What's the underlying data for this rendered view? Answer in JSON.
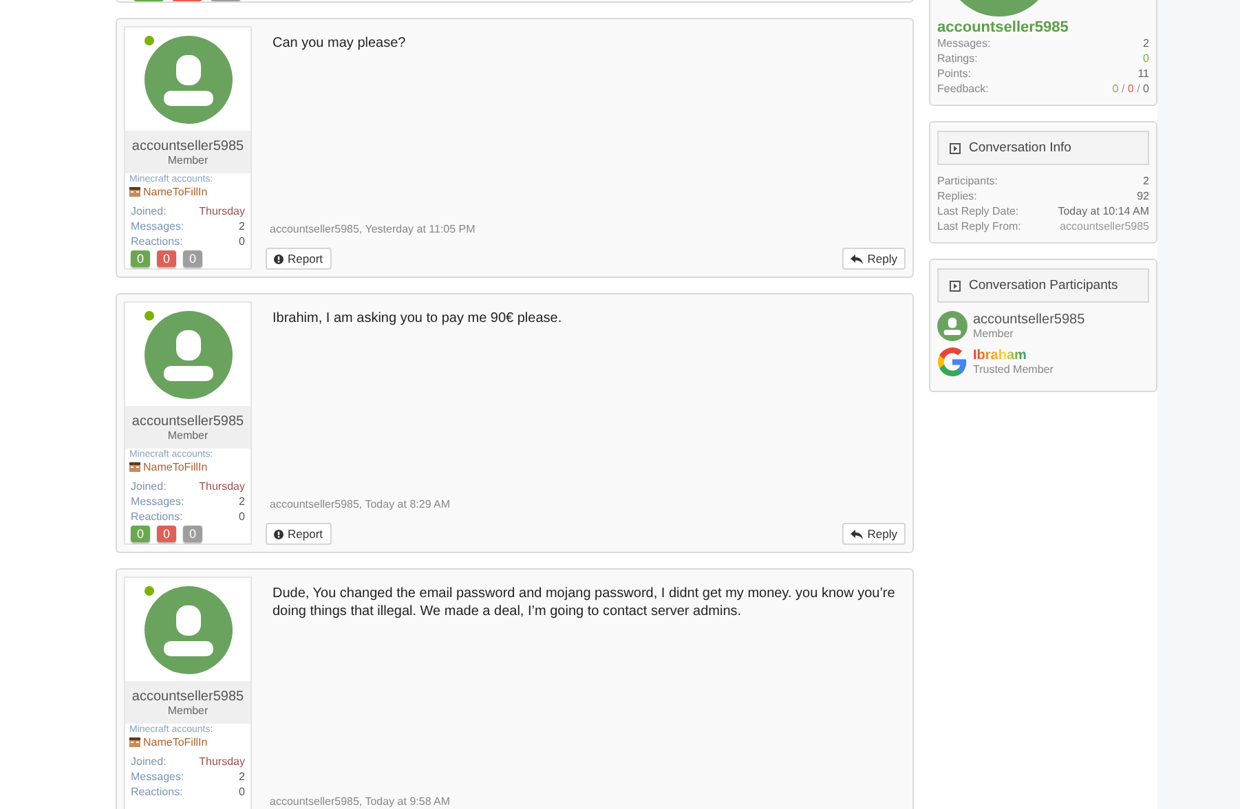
{
  "previous_post": {
    "reactions": [
      {
        "color": "#6aa84f"
      },
      {
        "color": "#e06055"
      },
      {
        "color": "#9e9e9e"
      }
    ]
  },
  "posts": [
    {
      "author": "accountseller5985",
      "role": "Member",
      "online": true,
      "accounts_label": "Minecraft accounts:",
      "account": "NameToFillIn",
      "stats": [
        {
          "label": "Joined:",
          "value": "Thursday"
        },
        {
          "label": "Messages:",
          "value": "2"
        },
        {
          "label": "Reactions:",
          "value": "0"
        }
      ],
      "reactions": [
        {
          "count": "0",
          "color": "#6aa84f"
        },
        {
          "count": "0",
          "color": "#e06055"
        },
        {
          "count": "0",
          "color": "#9e9e9e"
        }
      ],
      "message": "Can you may please?",
      "meta": "accountseller5985, Yesterday at 11:05 PM",
      "actions": [
        {
          "kind": "report",
          "label": "Report"
        },
        {
          "kind": "reply",
          "label": "Reply"
        }
      ]
    },
    {
      "author": "accountseller5985",
      "role": "Member",
      "online": true,
      "accounts_label": "Minecraft accounts:",
      "account": "NameToFillIn",
      "stats": [
        {
          "label": "Joined:",
          "value": "Thursday"
        },
        {
          "label": "Messages:",
          "value": "2"
        },
        {
          "label": "Reactions:",
          "value": "0"
        }
      ],
      "reactions": [
        {
          "count": "0",
          "color": "#6aa84f"
        },
        {
          "count": "0",
          "color": "#e06055"
        },
        {
          "count": "0",
          "color": "#9e9e9e"
        }
      ],
      "message": "Ibrahim, I am asking you to pay me 90€ please.",
      "meta": "accountseller5985, Today at 8:29 AM",
      "actions": [
        {
          "kind": "report",
          "label": "Report"
        },
        {
          "kind": "reply",
          "label": "Reply"
        }
      ]
    },
    {
      "author": "accountseller5985",
      "role": "Member",
      "online": true,
      "accounts_label": "Minecraft accounts:",
      "account": "NameToFillIn",
      "stats": [
        {
          "label": "Joined:",
          "value": "Thursday"
        },
        {
          "label": "Messages:",
          "value": "2"
        },
        {
          "label": "Reactions:",
          "value": "0"
        }
      ],
      "message": "Dude, You changed the email password and mojang password, I didnt get my money. you know you’re doing things that illegal. We made a deal, I’m going to contact server admins.",
      "meta": "accountseller5985, Today at 9:58 AM"
    }
  ],
  "sidebar": {
    "profile": {
      "name": "accountseller5985",
      "stats": [
        {
          "label": "Messages:",
          "parts": [
            {
              "text": "2",
              "kind": "plain"
            }
          ]
        },
        {
          "label": "Ratings:",
          "parts": [
            {
              "text": "0",
              "kind": "positive"
            }
          ]
        },
        {
          "label": "Points:",
          "parts": [
            {
              "text": "11",
              "kind": "plain"
            }
          ]
        },
        {
          "label": "Feedback:",
          "parts": [
            {
              "text": "0",
              "kind": "positive"
            },
            {
              "text": " / ",
              "kind": "separator"
            },
            {
              "text": "0",
              "kind": "negative"
            },
            {
              "text": " / ",
              "kind": "separator"
            },
            {
              "text": "0",
              "kind": "plain"
            }
          ]
        }
      ]
    },
    "conversation_info": {
      "title": "Conversation Info",
      "rows": [
        {
          "label": "Participants:",
          "value": "2",
          "kind": "plain"
        },
        {
          "label": "Replies:",
          "value": "92",
          "kind": "plain"
        },
        {
          "label": "Last Reply Date:",
          "value": "Today at 10:14 AM",
          "kind": "plain"
        },
        {
          "label": "Last Reply From:",
          "value": "accountseller5985",
          "kind": "muted"
        }
      ]
    },
    "participants": {
      "title": "Conversation Participants",
      "items": [
        {
          "name": "accountseller5985",
          "role": "Member",
          "kind": "standard"
        },
        {
          "name": "Ibraham",
          "role": "Trusted Member",
          "kind": "branded"
        }
      ]
    }
  }
}
